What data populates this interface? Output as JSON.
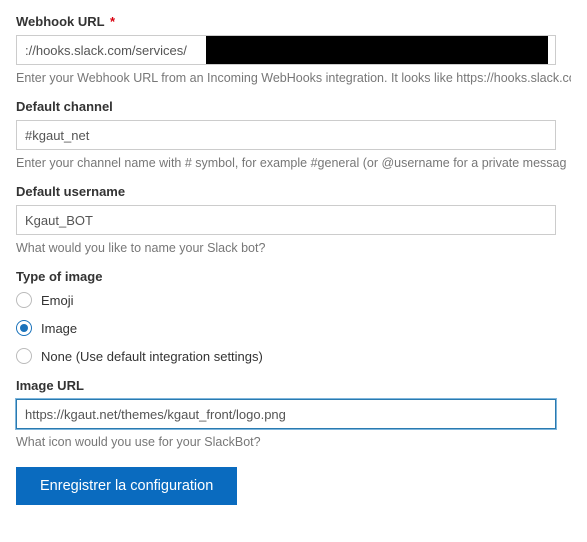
{
  "webhook": {
    "label": "Webhook URL",
    "required_mark": "*",
    "value": "://hooks.slack.com/services/",
    "help": "Enter your Webhook URL from an Incoming WebHooks integration. It looks like https://hooks.slack.co"
  },
  "channel": {
    "label": "Default channel",
    "value": "#kgaut_net",
    "help": "Enter your channel name with # symbol, for example #general (or @username for a private messag"
  },
  "username": {
    "label": "Default username",
    "value": "Kgaut_BOT",
    "help": "What would you like to name your Slack bot?"
  },
  "image_type": {
    "label": "Type of image",
    "options": {
      "emoji": "Emoji",
      "image": "Image",
      "none": "None (Use default integration settings)"
    },
    "selected": "image"
  },
  "image_url": {
    "label": "Image URL",
    "value": "https://kgaut.net/themes/kgaut_front/logo.png",
    "help": "What icon would you use for your SlackBot?"
  },
  "submit": {
    "label": "Enregistrer la configuration"
  }
}
